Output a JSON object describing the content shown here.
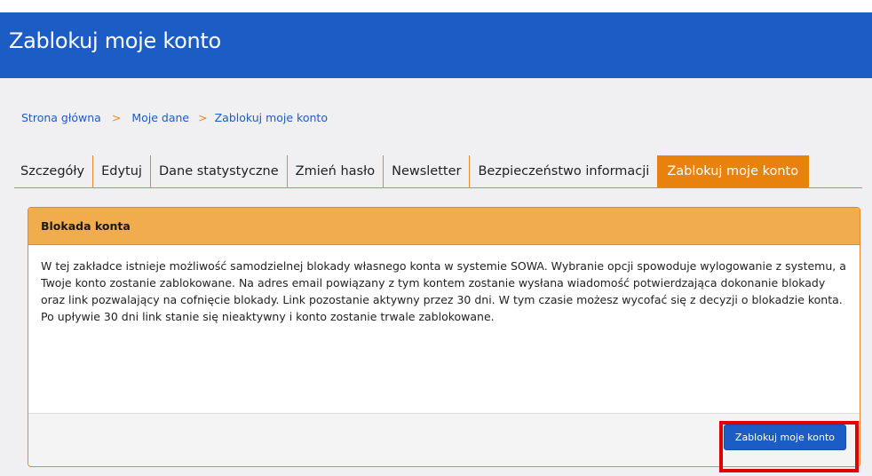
{
  "header": {
    "title": "Zablokuj moje konto"
  },
  "breadcrumb": {
    "items": [
      "Strona główna",
      "Moje dane",
      "Zablokuj moje konto"
    ],
    "separator": ">"
  },
  "tabs": [
    {
      "label": "Szczegóły",
      "active": false
    },
    {
      "label": "Edytuj",
      "active": false
    },
    {
      "label": "Dane statystyczne",
      "active": false
    },
    {
      "label": "Zmień hasło",
      "active": false
    },
    {
      "label": "Newsletter",
      "active": false
    },
    {
      "label": "Bezpieczeństwo informacji",
      "active": false
    },
    {
      "label": "Zablokuj moje konto",
      "active": true
    }
  ],
  "panel": {
    "title": "Blokada konta",
    "description": "W tej zakładce istnieje możliwość samodzielnej blokady własnego konta w systemie SOWA. Wybranie opcji spowoduje wylogowanie z systemu, a Twoje konto zostanie zablokowane. Na adres email powiązany z tym kontem zostanie wysłana wiadomość potwierdzająca dokonanie blokady oraz link pozwalający na cofnięcie blokady. Link pozostanie aktywny przez 30 dni. W tym czasie możesz wycofać się z decyzji o blokadzie konta. Po upływie 30 dni link stanie się nieaktywny i konto zostanie trwale zablokowane.",
    "button_label": "Zablokuj moje konto"
  },
  "colors": {
    "header_blue": "#1c5cc5",
    "accent_orange": "#e8820c",
    "panel_heading": "#f1ac4e",
    "highlight_red": "#e10000"
  }
}
